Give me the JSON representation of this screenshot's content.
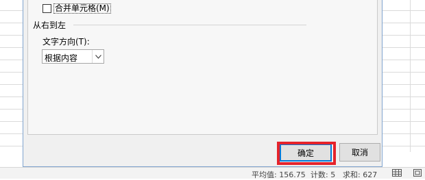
{
  "dialog": {
    "merge_cells_label": "合并单元格(M)",
    "rtl_section_title": "从右到左",
    "text_direction_label": "文字方向(T):",
    "text_direction_value": "根据内容",
    "ok_label": "确定",
    "cancel_label": "取消"
  },
  "statusbar": {
    "average": "平均值: 156.75",
    "count": "计数: 5",
    "sum": "求和: 627"
  },
  "colors": {
    "highlight": "#e5232b",
    "focus_border": "#0078d7"
  },
  "icons": [
    "chevron-down-icon",
    "normal-view-icon",
    "page-layout-icon"
  ]
}
